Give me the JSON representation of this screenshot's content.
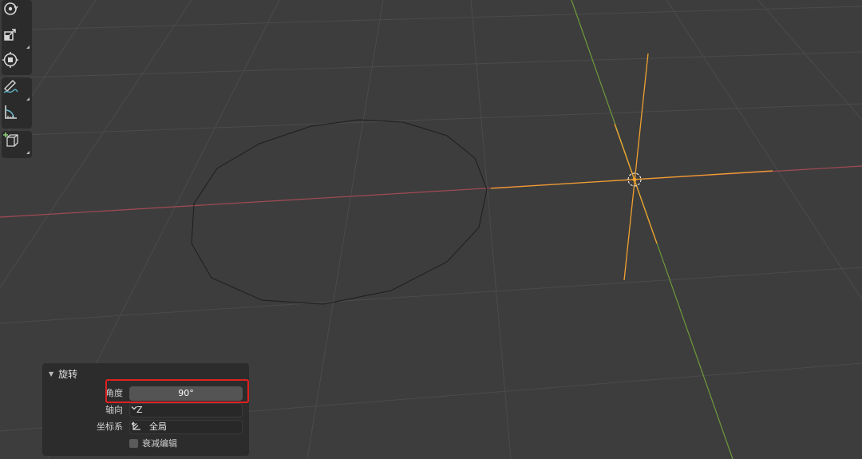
{
  "panel": {
    "title": "旋转",
    "angle_label": "角度",
    "angle_value": "90°",
    "axis_label": "轴向",
    "axis_value": "Z",
    "orient_label": "坐标系",
    "orient_value": "全局",
    "proportional_label": "衰减编辑",
    "proportional_checked": false
  },
  "toolbar": {
    "tools": [
      "rotate-icon",
      "scale-icon",
      "transform-icon",
      "annotate-icon",
      "measure-icon",
      "add-cube-icon"
    ]
  },
  "colors": {
    "background": "#3d3d3d",
    "grid": "#4a4a4a",
    "x_axis": "#a34a55",
    "y_axis": "#6f9a3a",
    "selection": "#f0a030",
    "highlight": "#e02020"
  }
}
